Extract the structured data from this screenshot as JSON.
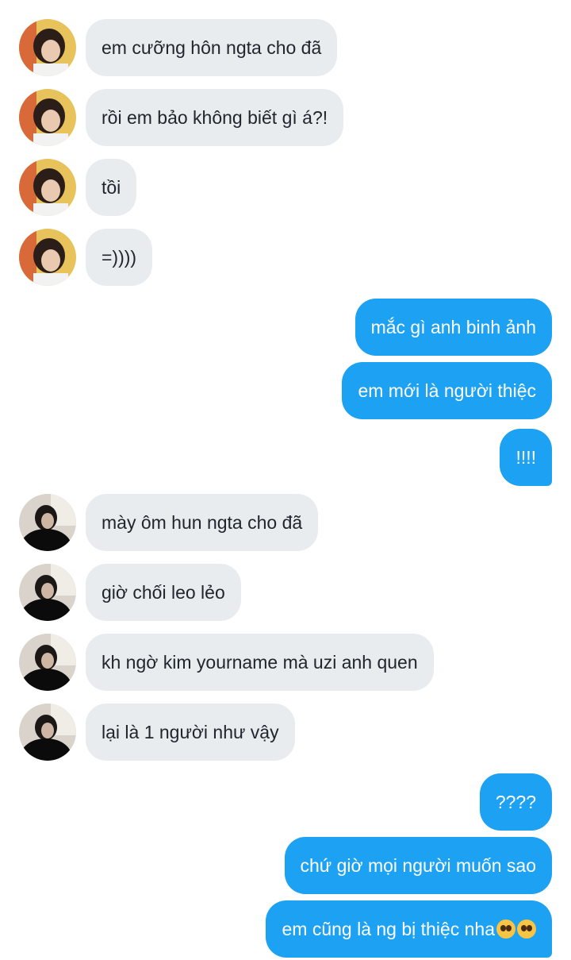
{
  "messages": [
    {
      "side": "in",
      "avatar": "a",
      "text": "em cưỡng hôn ngta cho đã"
    },
    {
      "side": "in",
      "avatar": "a",
      "text": "rồi em bảo không biết gì á?!"
    },
    {
      "side": "in",
      "avatar": "a",
      "text": "tồi"
    },
    {
      "side": "in",
      "avatar": "a",
      "text": "=))))"
    },
    {
      "side": "out",
      "text": "mắc gì anh binh ảnh"
    },
    {
      "side": "out",
      "text": "em mới là người thiệc"
    },
    {
      "side": "out",
      "text": "!!!!"
    },
    {
      "side": "in",
      "avatar": "b",
      "text": "mày ôm hun ngta cho đã"
    },
    {
      "side": "in",
      "avatar": "b",
      "text": "giờ chối leo lẻo"
    },
    {
      "side": "in",
      "avatar": "b",
      "text": "kh ngờ kim yourname mà uzi anh quen"
    },
    {
      "side": "in",
      "avatar": "b",
      "text": "lại là 1 người như vậy"
    },
    {
      "side": "out",
      "text": "????"
    },
    {
      "side": "out",
      "text": "chứ giờ mọi người muốn sao"
    },
    {
      "side": "out",
      "text": "em cũng là ng bị thiệc nha",
      "emoji": [
        "pleading-face-emoji",
        "pleading-face-emoji"
      ]
    }
  ],
  "colors": {
    "incoming_bubble": "#e9ecef",
    "outgoing_bubble": "#1da1f2"
  },
  "avatars": {
    "a": "user-a-avatar",
    "b": "user-b-avatar"
  }
}
